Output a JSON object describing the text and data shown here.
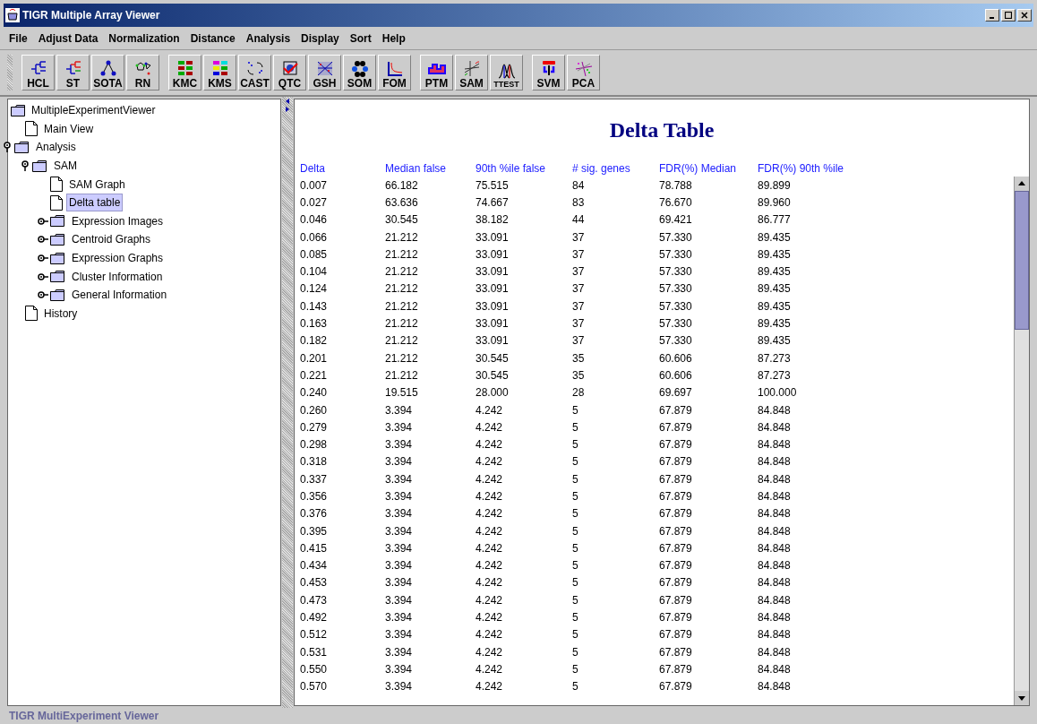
{
  "window": {
    "title": "TIGR Multiple Array Viewer"
  },
  "menu": [
    "File",
    "Adjust Data",
    "Normalization",
    "Distance",
    "Analysis",
    "Display",
    "Sort",
    "Help"
  ],
  "toolbar": {
    "groups": [
      {
        "buttons": [
          "HCL",
          "ST",
          "SOTA",
          "RN"
        ]
      },
      {
        "buttons": [
          "KMC",
          "KMS",
          "CAST",
          "QTC",
          "GSH",
          "SOM",
          "FOM"
        ]
      },
      {
        "buttons": [
          "PTM",
          "SAM",
          "TTEST"
        ]
      },
      {
        "buttons": [
          "SVM",
          "PCA"
        ]
      }
    ]
  },
  "tree": {
    "label": "MultipleExperimentViewer",
    "kind": "folder",
    "selected": false,
    "children": [
      {
        "label": "Main View",
        "kind": "page",
        "selected": false
      },
      {
        "label": "Analysis",
        "kind": "folder",
        "selected": false,
        "expanded": true,
        "children": [
          {
            "label": "SAM",
            "kind": "folder",
            "selected": false,
            "expanded": true,
            "children": [
              {
                "label": "SAM Graph",
                "kind": "page",
                "selected": false
              },
              {
                "label": "Delta table",
                "kind": "page",
                "selected": true
              },
              {
                "label": "Expression Images",
                "kind": "folder",
                "selected": false,
                "expanded": false
              },
              {
                "label": "Centroid Graphs",
                "kind": "folder",
                "selected": false,
                "expanded": false
              },
              {
                "label": "Expression Graphs",
                "kind": "folder",
                "selected": false,
                "expanded": false
              },
              {
                "label": "Cluster Information",
                "kind": "folder",
                "selected": false,
                "expanded": false
              },
              {
                "label": "General Information",
                "kind": "folder",
                "selected": false,
                "expanded": false
              }
            ]
          }
        ]
      },
      {
        "label": "History",
        "kind": "page",
        "selected": false
      }
    ]
  },
  "table": {
    "title": "Delta Table",
    "columns": [
      "Delta",
      "Median false",
      "90th %ile false",
      "# sig. genes",
      "FDR(%) Median",
      "FDR(%) 90th %ile"
    ],
    "rows": [
      [
        "0.007",
        "66.182",
        "75.515",
        "84",
        "78.788",
        "89.899"
      ],
      [
        "0.027",
        "63.636",
        "74.667",
        "83",
        "76.670",
        "89.960"
      ],
      [
        "0.046",
        "30.545",
        "38.182",
        "44",
        "69.421",
        "86.777"
      ],
      [
        "0.066",
        "21.212",
        "33.091",
        "37",
        "57.330",
        "89.435"
      ],
      [
        "0.085",
        "21.212",
        "33.091",
        "37",
        "57.330",
        "89.435"
      ],
      [
        "0.104",
        "21.212",
        "33.091",
        "37",
        "57.330",
        "89.435"
      ],
      [
        "0.124",
        "21.212",
        "33.091",
        "37",
        "57.330",
        "89.435"
      ],
      [
        "0.143",
        "21.212",
        "33.091",
        "37",
        "57.330",
        "89.435"
      ],
      [
        "0.163",
        "21.212",
        "33.091",
        "37",
        "57.330",
        "89.435"
      ],
      [
        "0.182",
        "21.212",
        "33.091",
        "37",
        "57.330",
        "89.435"
      ],
      [
        "0.201",
        "21.212",
        "30.545",
        "35",
        "60.606",
        "87.273"
      ],
      [
        "0.221",
        "21.212",
        "30.545",
        "35",
        "60.606",
        "87.273"
      ],
      [
        "0.240",
        "19.515",
        "28.000",
        "28",
        "69.697",
        "100.000"
      ],
      [
        "0.260",
        "3.394",
        "4.242",
        "5",
        "67.879",
        "84.848"
      ],
      [
        "0.279",
        "3.394",
        "4.242",
        "5",
        "67.879",
        "84.848"
      ],
      [
        "0.298",
        "3.394",
        "4.242",
        "5",
        "67.879",
        "84.848"
      ],
      [
        "0.318",
        "3.394",
        "4.242",
        "5",
        "67.879",
        "84.848"
      ],
      [
        "0.337",
        "3.394",
        "4.242",
        "5",
        "67.879",
        "84.848"
      ],
      [
        "0.356",
        "3.394",
        "4.242",
        "5",
        "67.879",
        "84.848"
      ],
      [
        "0.376",
        "3.394",
        "4.242",
        "5",
        "67.879",
        "84.848"
      ],
      [
        "0.395",
        "3.394",
        "4.242",
        "5",
        "67.879",
        "84.848"
      ],
      [
        "0.415",
        "3.394",
        "4.242",
        "5",
        "67.879",
        "84.848"
      ],
      [
        "0.434",
        "3.394",
        "4.242",
        "5",
        "67.879",
        "84.848"
      ],
      [
        "0.453",
        "3.394",
        "4.242",
        "5",
        "67.879",
        "84.848"
      ],
      [
        "0.473",
        "3.394",
        "4.242",
        "5",
        "67.879",
        "84.848"
      ],
      [
        "0.492",
        "3.394",
        "4.242",
        "5",
        "67.879",
        "84.848"
      ],
      [
        "0.512",
        "3.394",
        "4.242",
        "5",
        "67.879",
        "84.848"
      ],
      [
        "0.531",
        "3.394",
        "4.242",
        "5",
        "67.879",
        "84.848"
      ],
      [
        "0.550",
        "3.394",
        "4.242",
        "5",
        "67.879",
        "84.848"
      ],
      [
        "0.570",
        "3.394",
        "4.242",
        "5",
        "67.879",
        "84.848"
      ]
    ]
  },
  "status_bar": "TIGR MultiExperiment Viewer"
}
